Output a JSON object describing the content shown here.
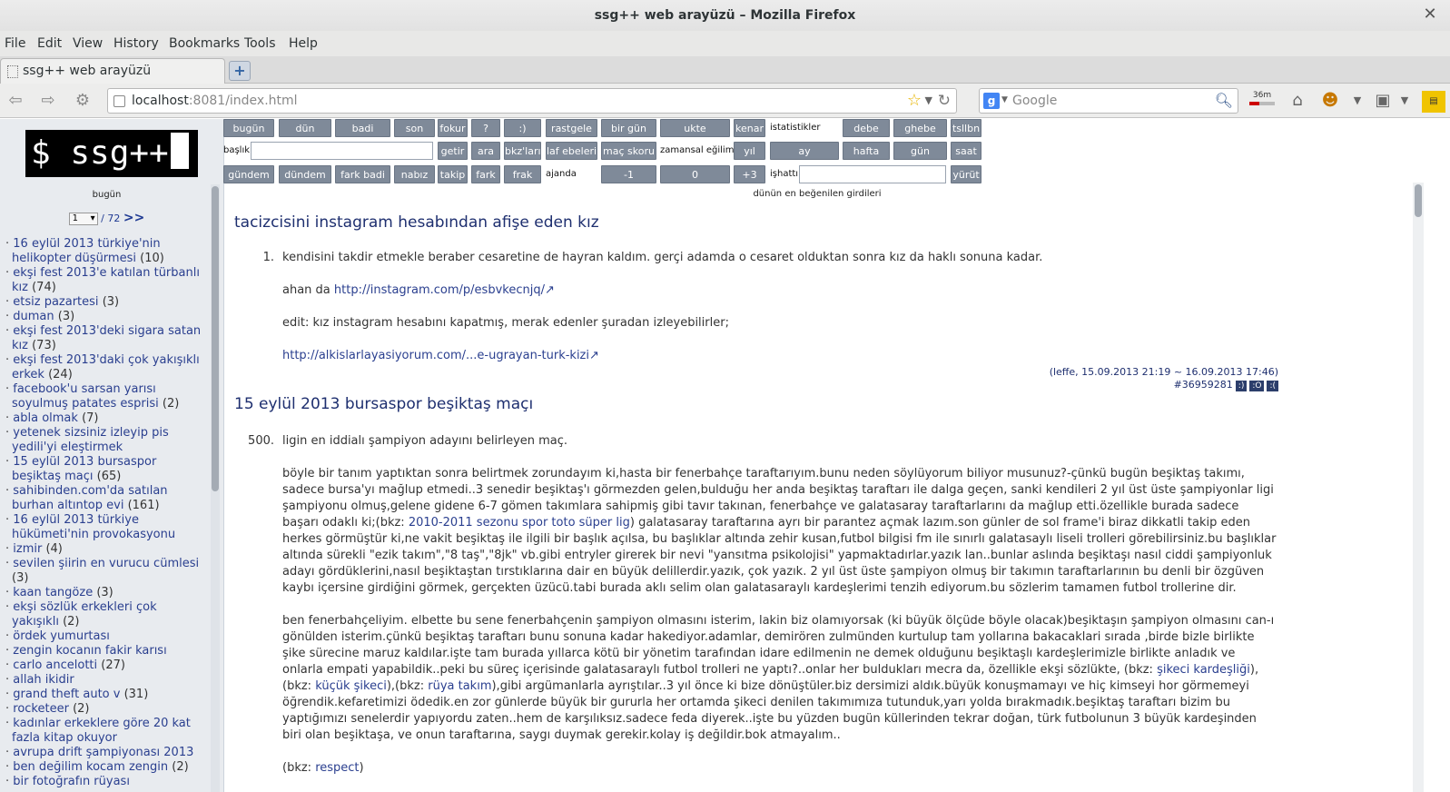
{
  "window": {
    "title": "ssg++ web arayüzü – Mozilla Firefox"
  },
  "menu": [
    "File",
    "Edit",
    "View",
    "History",
    "Bookmarks",
    "Tools",
    "Help"
  ],
  "tab": {
    "title": "ssg++ web arayüzü"
  },
  "url": {
    "host": "localhost",
    "rest": ":8081/index.html"
  },
  "search": {
    "placeholder": "Google"
  },
  "toolbar": {
    "timer_label": "36m"
  },
  "sidebar": {
    "logo": "$ ssg++",
    "day": "bugün",
    "page_current": "1",
    "page_total": "/ 72",
    "next": ">>",
    "topics": [
      {
        "title": "16 eylül 2013 türkiye'nin helikopter düşürmesi",
        "count": "(10)"
      },
      {
        "title": "ekşi fest 2013'e katılan türbanlı kız",
        "count": "(74)"
      },
      {
        "title": "etsiz pazartesi",
        "count": "(3)"
      },
      {
        "title": "duman",
        "count": "(3)"
      },
      {
        "title": "ekşi fest 2013'deki sigara satan kız",
        "count": "(73)"
      },
      {
        "title": "ekşi fest 2013'daki çok yakışıklı erkek",
        "count": "(24)"
      },
      {
        "title": "facebook'u sarsan yarısı soyulmuş patates esprisi",
        "count": "(2)"
      },
      {
        "title": "abla olmak",
        "count": "(7)"
      },
      {
        "title": "yetenek sizsiniz izleyip pis yedili'yi eleştirmek",
        "count": ""
      },
      {
        "title": "15 eylül 2013 bursaspor beşiktaş maçı",
        "count": "(65)"
      },
      {
        "title": "sahibinden.com'da satılan burhan altıntop evi",
        "count": "(161)"
      },
      {
        "title": "16 eylül 2013 türkiye hükümeti'nin provokasyonu",
        "count": ""
      },
      {
        "title": "izmir",
        "count": "(4)"
      },
      {
        "title": "sevilen şiirin en vurucu cümlesi",
        "count": "(3)"
      },
      {
        "title": "kaan tangöze",
        "count": "(3)"
      },
      {
        "title": "ekşi sözlük erkekleri çok yakışıklı",
        "count": "(2)"
      },
      {
        "title": "ördek yumurtası",
        "count": ""
      },
      {
        "title": "zengin kocanın fakir karısı",
        "count": ""
      },
      {
        "title": "carlo ancelotti",
        "count": "(27)"
      },
      {
        "title": "allah ikidir",
        "count": ""
      },
      {
        "title": "grand theft auto v",
        "count": "(31)"
      },
      {
        "title": "rocketeer",
        "count": "(2)"
      },
      {
        "title": "kadınlar erkeklere göre 20 kat fazla kitap okuyor",
        "count": ""
      },
      {
        "title": "avrupa drift şampiyonası 2013",
        "count": ""
      },
      {
        "title": "ben değilim kocam zengin",
        "count": "(2)"
      },
      {
        "title": "bir fotoğrafın rüyası",
        "count": ""
      }
    ]
  },
  "grid": {
    "row1": [
      "bugün",
      "dün",
      "badi",
      "son",
      "fokur",
      "?",
      ":)",
      "rastgele",
      "bir gün",
      "ukte",
      "kenar",
      "istatistikler",
      "debe",
      "ghebe",
      "tsllbn"
    ],
    "row2": {
      "baslik_label": "başlık",
      "buttons": [
        "getir",
        "ara",
        "bkz'ları",
        "laf ebeleri",
        "maç skoru",
        "zamansal eğilim",
        "yıl",
        "ay",
        "hafta",
        "gün",
        "saat"
      ]
    },
    "row3": {
      "buttons": [
        "gündem",
        "dündem",
        "fark badi",
        "nabız",
        "takip",
        "fark",
        "frak"
      ],
      "ajanda_label": "ajanda",
      "nums": [
        "-1",
        "0",
        "+3"
      ],
      "ishatti_label": "işhattı",
      "run": "yürüt"
    },
    "caption": "dünün en beğenilen girdileri"
  },
  "entries": [
    {
      "title": "tacizcisini instagram hesabından afişe eden kız",
      "number": "1.",
      "p1": "kendisini takdir etmekle beraber cesaretine de hayran kaldım. gerçi adamda o cesaret olduktan sonra kız da haklı sonuna kadar.",
      "p2_text": "ahan da ",
      "p2_link": "http://instagram.com/p/esbvkecnjq/↗",
      "p3": "edit: kız instagram hesabını kapatmış, merak edenler şuradan izleyebilirler;",
      "p4_link": "http://alkislarlayasiyorum.com/...e-ugrayan-turk-kizi↗",
      "meta": "(leffe, 15.09.2013 21:19 ~ 16.09.2013 17:46)",
      "id": "#36959281",
      "votes": [
        ":)",
        ":O",
        ":("
      ]
    },
    {
      "title": "15 eylül 2013 bursaspor beşiktaş maçı",
      "number": "500.",
      "p1": "ligin en iddialı şampiyon adayını belirleyen maç.",
      "p2a": "böyle bir tanım yaptıktan sonra belirtmek zorundayım ki,hasta bir fenerbahçe taraftarıyım.bunu neden söylüyorum biliyor musunuz?-çünkü bugün beşiktaş takımı, sadece bursa'yı mağlup etmedi..3 senedir beşiktaş'ı görmezden gelen,bulduğu her anda beşiktaş taraftarı ile dalga geçen, sanki kendileri 2 yıl üst üste şampiyonlar ligi şampiyonu olmuş,gelene gidene 6-7 gömen takımlara sahipmiş gibi tavır takınan, fenerbahçe ve galatasaray taraftarlarını da mağlup etti.özellikle burada sadece başarı odaklı ki;(bkz: ",
      "p2_link": "2010-2011 sezonu spor toto süper lig",
      "p2b": ") galatasaray taraftarına ayrı bir parantez açmak lazım.son günler de sol frame'i biraz dikkatli takip eden herkes görmüştür ki,ne vakit beşiktaş ile ilgili bir başlık açılsa, bu başlıklar altında zehir kusan,futbol bilgisi fm ile sınırlı galatasaylı liseli trolleri görebilirsiniz.bu başlıklar altında sürekli \"ezik takım\",\"8 taş\",\"8jk\" vb.gibi entryler girerek bir nevi \"yansıtma psikolojisi\" yapmaktadırlar.yazık lan..bunlar aslında beşiktaşı nasıl ciddi şampiyonluk adayı gördüklerini,nasıl beşiktaştan tırstıklarına dair en büyük delillerdir.yazık, çok yazık. 2 yıl üst üste şampiyon olmuş bir takımın taraftarlarının bu denli bir özgüven kaybı içersine girdiğini görmek, gerçekten üzücü.tabi burada aklı selim olan galatasaraylı kardeşlerimi tenzih ediyorum.bu sözlerim tamamen futbol trollerine dir.",
      "p3a": "ben fenerbahçeliyim. elbette bu sene fenerbahçenin şampiyon olmasını isterim, lakin biz olamıyorsak (ki büyük ölçüde böyle olacak)beşiktaşın şampiyon olmasını can-ı gönülden isterim.çünkü beşiktaş taraftarı bunu sonuna kadar hakediyor.adamlar, demirören zulmünden kurtulup tam yollarına bakacaklari sırada ,birde bizle birlikte şike sürecine maruz kaldılar.işte tam burada yıllarca kötü bir yönetim tarafından idare edilmenin ne demek olduğunu beşiktaşlı kardeşlerimizle birlikte anladık ve onlarla empati yapabildik..peki bu süreç içerisinde galatasaraylı futbol trolleri ne yaptı?..onlar her buldukları mecra da, özellikle ekşi sözlükte, (bkz: ",
      "p3_link1": "şikeci kardeşliği",
      "p3_mid1": "),(bkz: ",
      "p3_link2": "küçük şikeci",
      "p3_mid2": "),(bkz: ",
      "p3_link3": "rüya takım",
      "p3b": "),gibi argümanlarla ayrıştılar..3 yıl önce ki bize dönüştüler.biz dersimizi aldık.büyük konuşmamayı ve hiç kimseyi hor görmemeyi öğrendik.kefaretimizi ödedik.en zor günlerde büyük bir gururla her ortamda şikeci denilen takımımıza tutunduk,yarı yolda bırakmadık.beşiktaş taraftarı bizim bu yaptığımızı senelerdir yapıyordu zaten..hem de karşılıksız.sadece feda diyerek..işte bu yüzden bugün küllerinden tekrar doğan, türk futbolunun 3 büyük kardeşinden biri olan beşiktaşa, ve onun taraftarına, saygı duymak gerekir.kolay iş değildir.bok atmayalım..",
      "p4a": "(bkz: ",
      "p4_link": "respect",
      "p4b": ")"
    }
  ]
}
